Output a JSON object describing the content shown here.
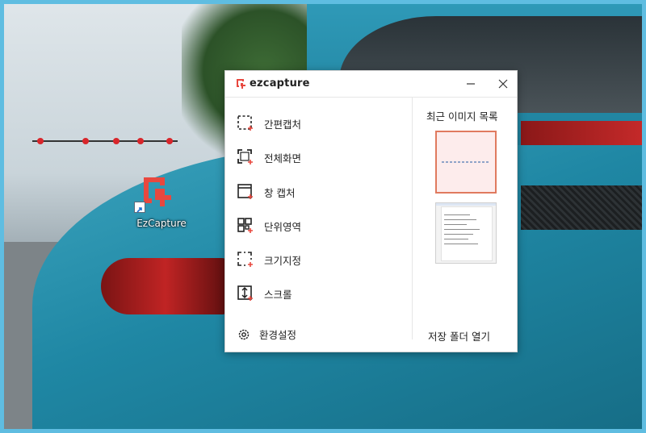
{
  "desktop": {
    "shortcut_label": "EzCapture"
  },
  "window": {
    "app_title": "ezcapture",
    "minimize_symbol": "—",
    "close_symbol": "✕"
  },
  "menu": {
    "items": [
      {
        "label": "간편캡처",
        "icon": "simple-capture-icon"
      },
      {
        "label": "전체화면",
        "icon": "fullscreen-capture-icon"
      },
      {
        "label": "창 캡처",
        "icon": "window-capture-icon"
      },
      {
        "label": "단위영역",
        "icon": "unit-area-icon"
      },
      {
        "label": "크기지정",
        "icon": "size-specify-icon"
      },
      {
        "label": "스크롤",
        "icon": "scroll-capture-icon"
      }
    ],
    "settings_label": "환경설정"
  },
  "recent": {
    "title": "최근 이미지 목록",
    "open_folder_label": "저장 폴더 열기"
  },
  "colors": {
    "brand": "#e8483f",
    "thumb_selected_border": "#e07a5f",
    "frame_border": "#5fbde1"
  }
}
